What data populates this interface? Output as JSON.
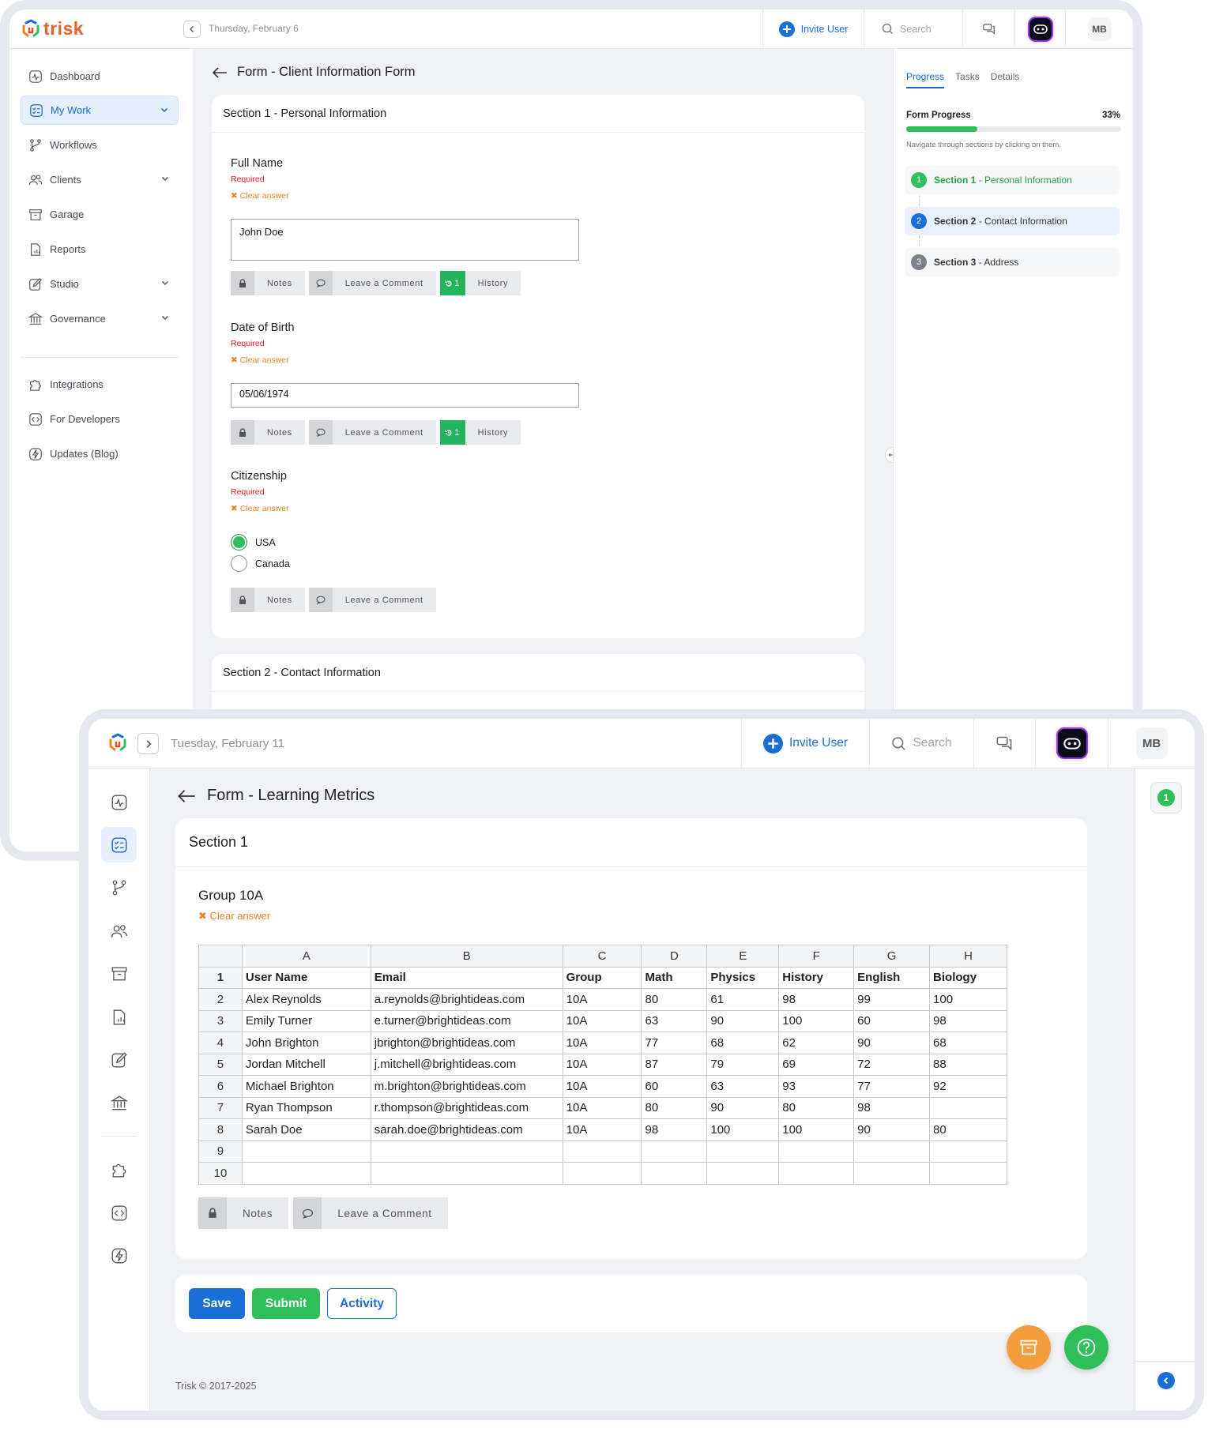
{
  "brand": {
    "name": "trisk"
  },
  "screen1": {
    "header": {
      "date": "Thursday, February 6",
      "invite_label": "Invite User",
      "search_placeholder": "Search",
      "user_initials": "MB"
    },
    "sidebar": {
      "items": [
        {
          "label": "Dashboard",
          "icon": "activity-icon"
        },
        {
          "label": "My Work",
          "icon": "checklist-icon"
        },
        {
          "label": "Workflows",
          "icon": "branch-icon"
        },
        {
          "label": "Clients",
          "icon": "users-icon"
        },
        {
          "label": "Garage",
          "icon": "archive-icon"
        },
        {
          "label": "Reports",
          "icon": "report-icon"
        },
        {
          "label": "Studio",
          "icon": "edit-icon"
        },
        {
          "label": "Governance",
          "icon": "bank-icon"
        }
      ],
      "bottom_items": [
        {
          "label": "Integrations",
          "icon": "puzzle-icon"
        },
        {
          "label": "For Developers",
          "icon": "code-icon"
        },
        {
          "label": "Updates (Blog)",
          "icon": "bolt-icon"
        }
      ]
    },
    "form": {
      "title": "Form - Client Information Form",
      "section1_title": "Section 1 - Personal Information",
      "section2_title": "Section 2 - Contact Information",
      "questions": {
        "full_name": {
          "label": "Full Name",
          "required": "Required",
          "clear": "Clear answer",
          "value": "John Doe"
        },
        "dob": {
          "label": "Date of Birth",
          "required": "Required",
          "clear": "Clear answer",
          "value": "05/06/1974"
        },
        "citizenship": {
          "label": "Citizenship",
          "required": "Required",
          "clear": "Clear answer",
          "options": [
            "USA",
            "Canada"
          ],
          "selected": "USA"
        }
      },
      "toolbar": {
        "notes": "Notes",
        "comment": "Leave a Comment",
        "history": "History",
        "history_count": "1"
      }
    },
    "right_panel": {
      "tabs": [
        "Progress",
        "Tasks",
        "Details"
      ],
      "active_tab": "Progress",
      "progress_label": "Form Progress",
      "progress_value": "33%",
      "progress_fraction": 0.33,
      "hint": "Navigate through sections by clicking on them.",
      "sections": [
        {
          "num": "1",
          "name": "Section 1",
          "detail": " - Personal Information",
          "status": "complete"
        },
        {
          "num": "2",
          "name": "Section 2",
          "detail": " - Contact Information",
          "status": "current"
        },
        {
          "num": "3",
          "name": "Section 3",
          "detail": " - Address",
          "status": "pending"
        }
      ]
    }
  },
  "screen2": {
    "header": {
      "date": "Tuesday, February 11",
      "invite_label": "Invite User",
      "search_placeholder": "Search",
      "user_initials": "MB"
    },
    "form": {
      "title": "Form - Learning Metrics",
      "section_title": "Section 1",
      "group_label": "Group 10A",
      "clear": "Clear answer",
      "sheet": {
        "columns": [
          "A",
          "B",
          "C",
          "D",
          "E",
          "F",
          "G",
          "H"
        ],
        "rows": [
          [
            "1",
            "User Name",
            "Email",
            "Group",
            "Math",
            "Physics",
            "History",
            "English",
            "Biology"
          ],
          [
            "2",
            "Alex Reynolds",
            "a.reynolds@brightideas.com",
            "10A",
            "80",
            "61",
            "98",
            "99",
            "100"
          ],
          [
            "3",
            "Emily Turner",
            "e.turner@brightideas.com",
            "10A",
            "63",
            "90",
            "100",
            "60",
            "98"
          ],
          [
            "4",
            "John Brighton",
            "jbrighton@brightideas.com",
            "10A",
            "77",
            "68",
            "62",
            "90",
            "68"
          ],
          [
            "5",
            "Jordan Mitchell",
            "j.mitchell@brightideas.com",
            "10A",
            "87",
            "79",
            "69",
            "72",
            "88"
          ],
          [
            "6",
            "Michael Brighton",
            "m.brighton@brightideas.com",
            "10A",
            "60",
            "63",
            "93",
            "77",
            "92"
          ],
          [
            "7",
            "Ryan Thompson",
            "r.thompson@brightideas.com",
            "10A",
            "80",
            "90",
            "80",
            "98",
            ""
          ],
          [
            "8",
            "Sarah Doe",
            "sarah.doe@brightideas.com",
            "10A",
            "98",
            "100",
            "100",
            "90",
            "80"
          ],
          [
            "9",
            "",
            "",
            "",
            "",
            "",
            "",
            "",
            ""
          ],
          [
            "10",
            "",
            "",
            "",
            "",
            "",
            "",
            "",
            ""
          ]
        ]
      },
      "toolbar": {
        "notes": "Notes",
        "comment": "Leave a Comment"
      },
      "actions": {
        "save": "Save",
        "submit": "Submit",
        "activity": "Activity"
      }
    },
    "right_badge": "1",
    "footer": "Trisk © 2017-2025"
  },
  "colors": {
    "primary": "#1a6fd6",
    "success": "#2fbf5a",
    "warning": "#f39c3c",
    "danger": "#e02020"
  }
}
